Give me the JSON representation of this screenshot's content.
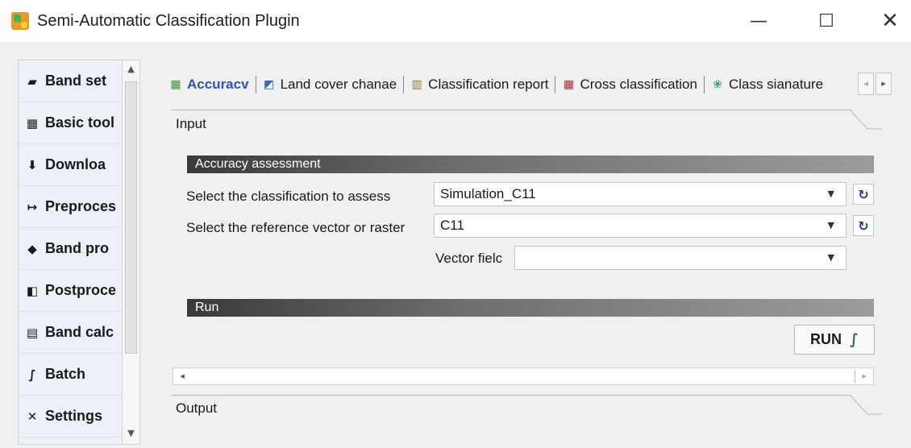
{
  "window": {
    "title": "Semi-Automatic Classification Plugin",
    "minimize_glyph": "—",
    "maximize_glyph": "☐",
    "close_glyph": "✕"
  },
  "sidebar": {
    "items": [
      {
        "label": "Band set",
        "icon": "band-set-icon",
        "glyph": "▰"
      },
      {
        "label": "Basic tool",
        "icon": "basic-tools-icon",
        "glyph": "▦"
      },
      {
        "label": "Downloa",
        "icon": "download-icon",
        "glyph": "⬇"
      },
      {
        "label": "Preproces",
        "icon": "preprocessing-icon",
        "glyph": "↦"
      },
      {
        "label": "Band pro",
        "icon": "band-processing-icon",
        "glyph": "◆"
      },
      {
        "label": "Postproce",
        "icon": "postprocessing-icon",
        "glyph": "◧"
      },
      {
        "label": "Band calc",
        "icon": "band-calc-icon",
        "glyph": "▤"
      },
      {
        "label": "Batch",
        "icon": "batch-icon",
        "glyph": "∫"
      },
      {
        "label": "Settings",
        "icon": "settings-icon",
        "glyph": "✕"
      }
    ]
  },
  "tabs": [
    {
      "label": "Accuracv",
      "icon": "accuracy-icon",
      "glyph": "▦",
      "active": true
    },
    {
      "label": "Land cover chanae",
      "icon": "land-cover-change-icon",
      "glyph": "◩",
      "active": false
    },
    {
      "label": "Classification report",
      "icon": "classification-report-icon",
      "glyph": "▥",
      "active": false
    },
    {
      "label": "Cross classification",
      "icon": "cross-classification-icon",
      "glyph": "▦",
      "active": false
    },
    {
      "label": "Class sianature",
      "icon": "class-signature-icon",
      "glyph": "❀",
      "active": false
    }
  ],
  "tab_nav": {
    "left": "◂",
    "right": "▸"
  },
  "sections": {
    "input_label": "Input",
    "output_label": "Output"
  },
  "accuracy_assessment": {
    "title": "Accuracy assessment",
    "classification_label": "Select the classification to assess",
    "classification_value": "Simulation_C11",
    "reference_label": "Select the reference vector or raster",
    "reference_value": "C11",
    "vector_field_label": "Vector fielc",
    "vector_field_value": "",
    "caret": "▼",
    "refresh_glyph": "↻"
  },
  "run": {
    "title": "Run",
    "button_label": "RUN",
    "button_glyph": "∫"
  },
  "hscroll": {
    "left": "◂",
    "right": "▸"
  },
  "colors": {
    "active_tab": "#2d55b8",
    "bar_dark": "#3a3a3a",
    "panel_bg": "#f0f0f0"
  }
}
